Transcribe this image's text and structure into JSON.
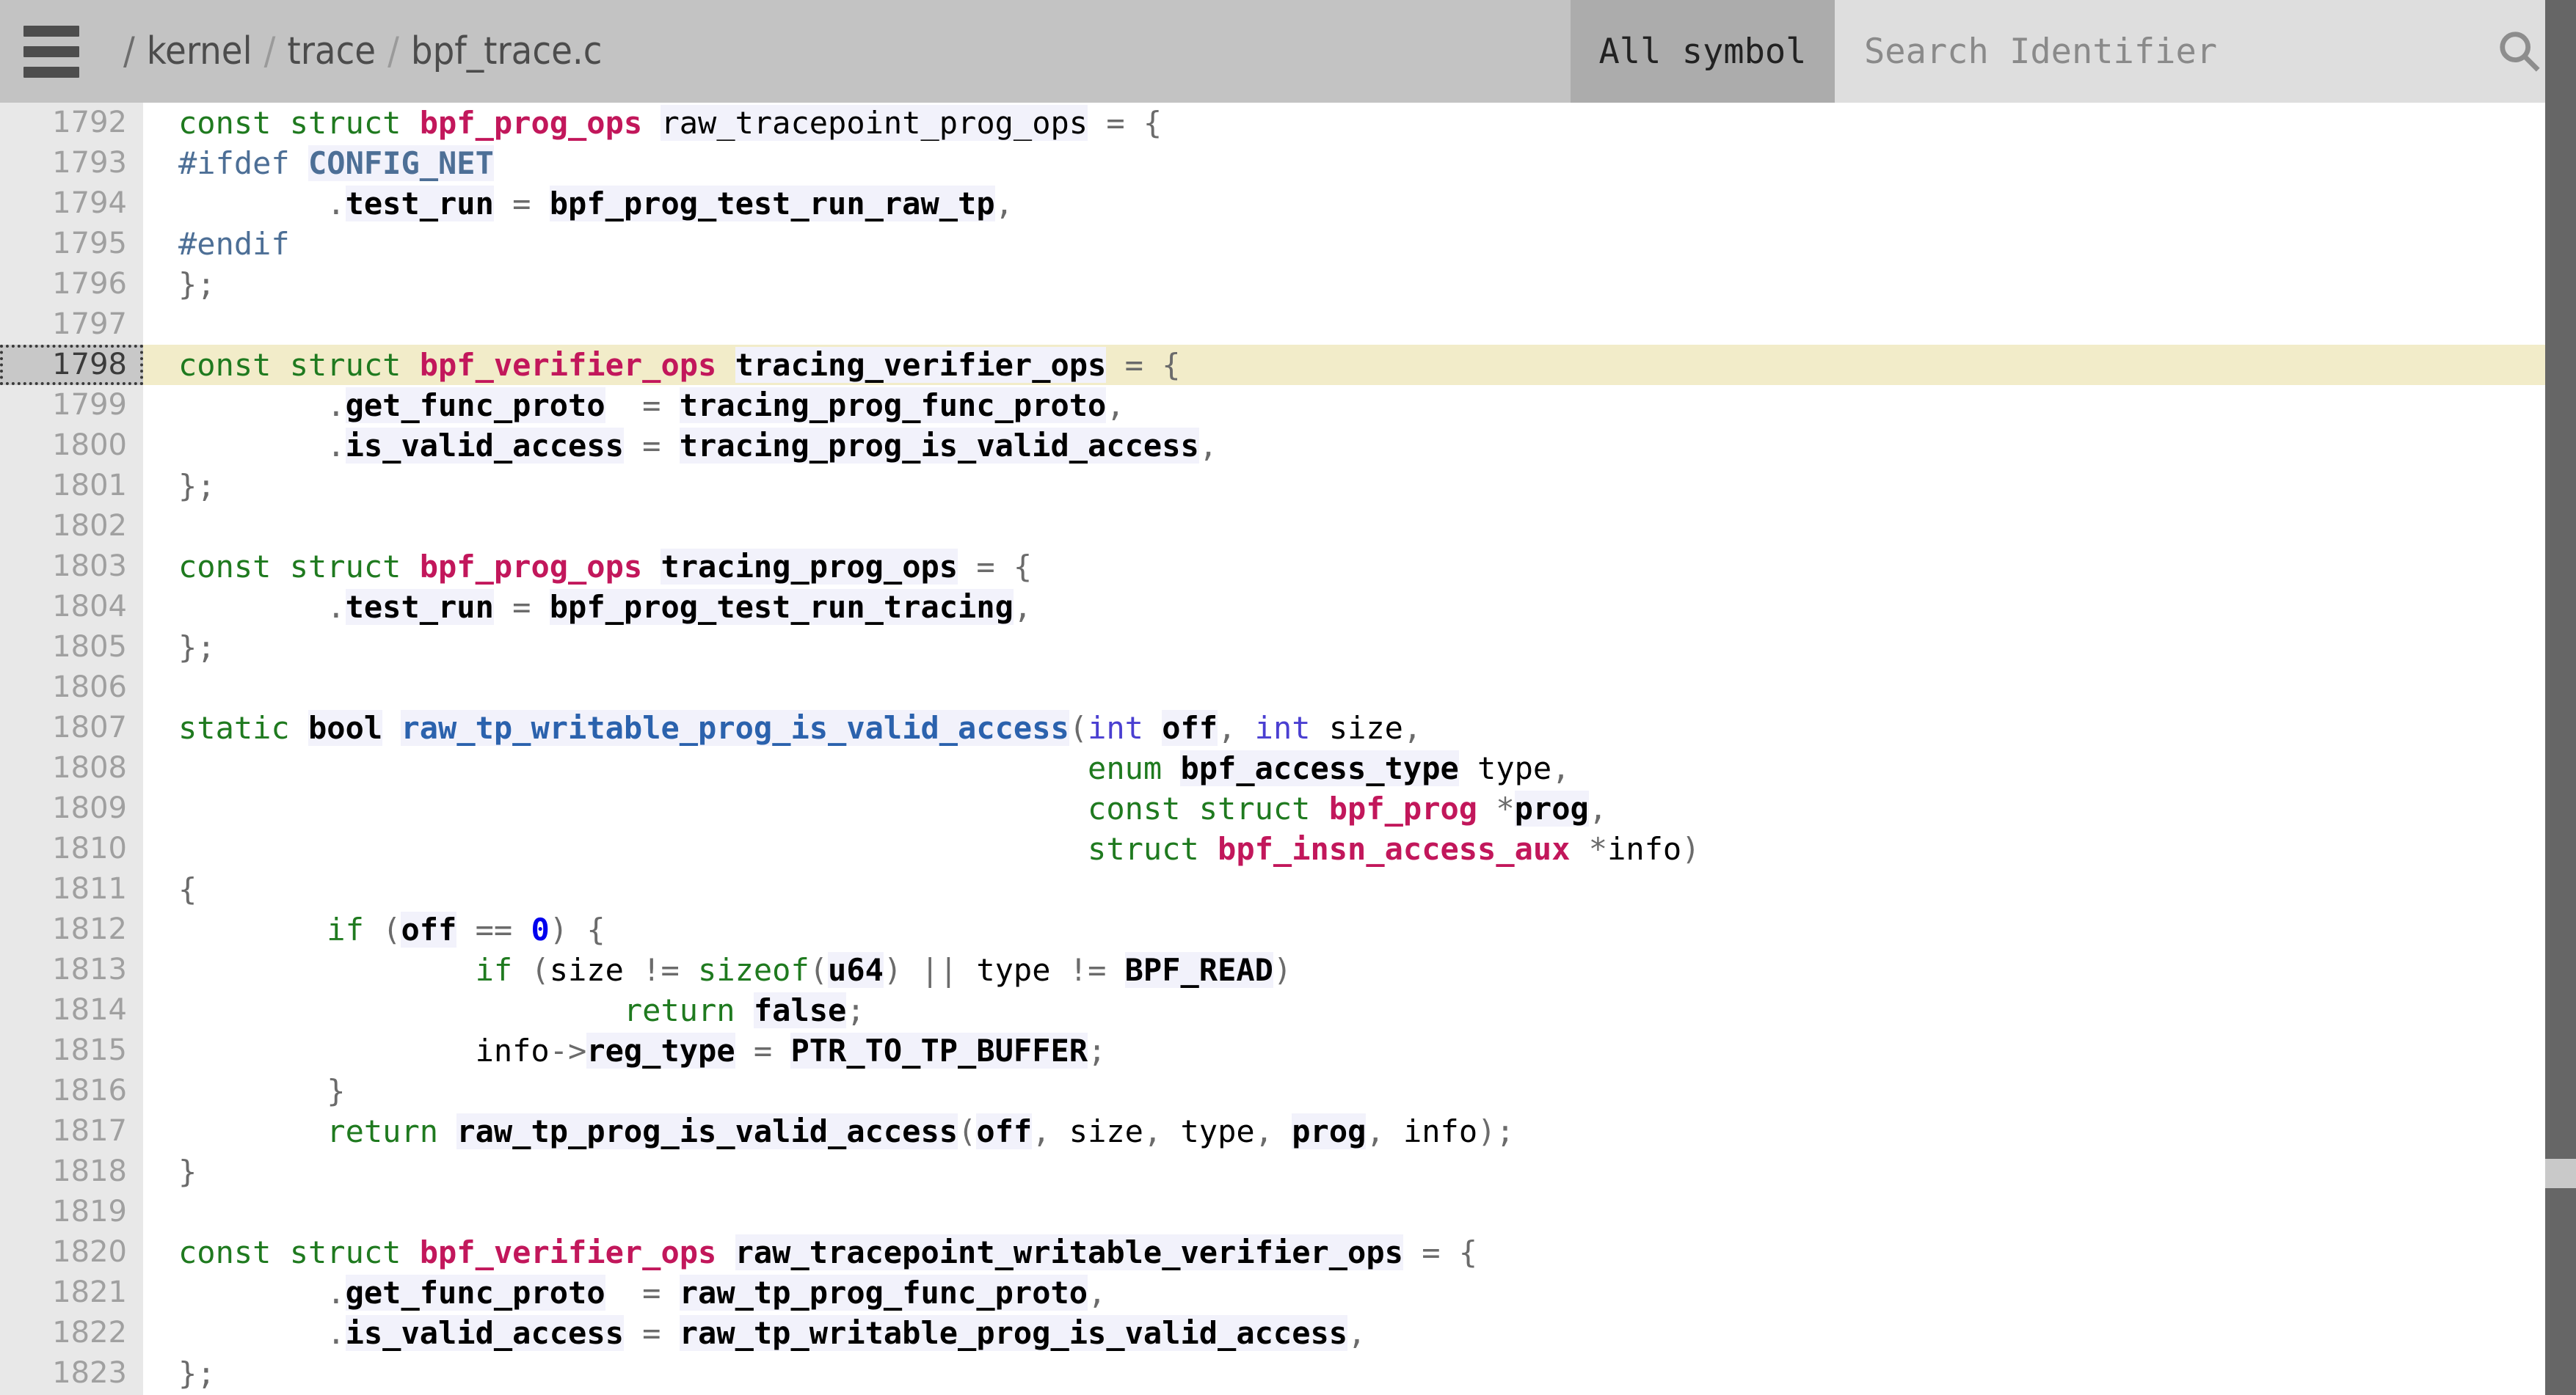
{
  "header": {
    "menu_icon": "hamburger-icon",
    "breadcrumb": {
      "leading_separator": "/",
      "separator": "/",
      "parts": [
        "kernel",
        "trace",
        "bpf_trace.c"
      ]
    },
    "scope_selector": {
      "label": "All symbol",
      "icon": "chevron-down-icon"
    },
    "search": {
      "value": "",
      "placeholder": "Search Identifier",
      "icon": "search-icon"
    }
  },
  "editor": {
    "highlighted_line": 1798,
    "first_line": 1792,
    "last_line": 1823,
    "colors": {
      "keyword": "#1f7a1f",
      "preprocessor": "#4d6f96",
      "type": "#c2175b",
      "function": "#2b62ad",
      "builtin": "#4a3fd1",
      "number": "#0000ee",
      "punctuation": "#6b6b6b",
      "identifier_bg": "#f2f2fb",
      "highlight_bg": "#f2ecc9",
      "gutter_bg": "#e8e8e8",
      "gutter_text": "#a0a0a0",
      "header_bg": "#c3c3c3",
      "scrollbar": "#666666"
    },
    "lines": [
      {
        "n": "1792",
        "text": "const struct bpf_prog_ops raw_tracepoint_prog_ops = {"
      },
      {
        "n": "1793",
        "text": "#ifdef CONFIG_NET"
      },
      {
        "n": "1794",
        "text": "        .test_run = bpf_prog_test_run_raw_tp,"
      },
      {
        "n": "1795",
        "text": "#endif"
      },
      {
        "n": "1796",
        "text": "};"
      },
      {
        "n": "1797",
        "text": ""
      },
      {
        "n": "1798",
        "text": "const struct bpf_verifier_ops tracing_verifier_ops = {"
      },
      {
        "n": "1799",
        "text": "        .get_func_proto  = tracing_prog_func_proto,"
      },
      {
        "n": "1800",
        "text": "        .is_valid_access = tracing_prog_is_valid_access,"
      },
      {
        "n": "1801",
        "text": "};"
      },
      {
        "n": "1802",
        "text": ""
      },
      {
        "n": "1803",
        "text": "const struct bpf_prog_ops tracing_prog_ops = {"
      },
      {
        "n": "1804",
        "text": "        .test_run = bpf_prog_test_run_tracing,"
      },
      {
        "n": "1805",
        "text": "};"
      },
      {
        "n": "1806",
        "text": ""
      },
      {
        "n": "1807",
        "text": "static bool raw_tp_writable_prog_is_valid_access(int off, int size,"
      },
      {
        "n": "1808",
        "text": "                                                 enum bpf_access_type type,"
      },
      {
        "n": "1809",
        "text": "                                                 const struct bpf_prog *prog,"
      },
      {
        "n": "1810",
        "text": "                                                 struct bpf_insn_access_aux *info)"
      },
      {
        "n": "1811",
        "text": "{"
      },
      {
        "n": "1812",
        "text": "        if (off == 0) {"
      },
      {
        "n": "1813",
        "text": "                if (size != sizeof(u64) || type != BPF_READ)"
      },
      {
        "n": "1814",
        "text": "                        return false;"
      },
      {
        "n": "1815",
        "text": "                info->reg_type = PTR_TO_TP_BUFFER;"
      },
      {
        "n": "1816",
        "text": "        }"
      },
      {
        "n": "1817",
        "text": "        return raw_tp_prog_is_valid_access(off, size, type, prog, info);"
      },
      {
        "n": "1818",
        "text": "}"
      },
      {
        "n": "1819",
        "text": ""
      },
      {
        "n": "1820",
        "text": "const struct bpf_verifier_ops raw_tracepoint_writable_verifier_ops = {"
      },
      {
        "n": "1821",
        "text": "        .get_func_proto  = raw_tp_prog_func_proto,"
      },
      {
        "n": "1822",
        "text": "        .is_valid_access = raw_tp_writable_prog_is_valid_access,"
      },
      {
        "n": "1823",
        "text": "};"
      }
    ],
    "tokens": {
      "1792": [
        [
          "kw",
          "const struct "
        ],
        [
          "ty",
          "bpf_prog_ops"
        ],
        [
          "plain",
          " "
        ],
        [
          "id",
          "raw_tracepoint_prog_ops"
        ],
        [
          "pun",
          " = {"
        ]
      ],
      "1793": [
        [
          "pp",
          "#ifdef "
        ],
        [
          "macro",
          "CONFIG_NET"
        ]
      ],
      "1794": [
        [
          "plain",
          "        "
        ],
        [
          "pun",
          "."
        ],
        [
          "idb",
          "test_run"
        ],
        [
          "pun",
          " = "
        ],
        [
          "idb",
          "bpf_prog_test_run_raw_tp"
        ],
        [
          "pun",
          ","
        ]
      ],
      "1795": [
        [
          "pp",
          "#endif"
        ]
      ],
      "1796": [
        [
          "pun",
          "};"
        ]
      ],
      "1797": [],
      "1798": [
        [
          "kw",
          "const struct "
        ],
        [
          "ty",
          "bpf_verifier_ops"
        ],
        [
          "plain",
          " "
        ],
        [
          "idb",
          "tracing_verifier_ops"
        ],
        [
          "pun",
          " = {"
        ]
      ],
      "1799": [
        [
          "plain",
          "        "
        ],
        [
          "pun",
          "."
        ],
        [
          "idb",
          "get_func_proto"
        ],
        [
          "pun",
          "  = "
        ],
        [
          "idb",
          "tracing_prog_func_proto"
        ],
        [
          "pun",
          ","
        ]
      ],
      "1800": [
        [
          "plain",
          "        "
        ],
        [
          "pun",
          "."
        ],
        [
          "idb",
          "is_valid_access"
        ],
        [
          "pun",
          " = "
        ],
        [
          "idb",
          "tracing_prog_is_valid_access"
        ],
        [
          "pun",
          ","
        ]
      ],
      "1801": [
        [
          "pun",
          "};"
        ]
      ],
      "1802": [],
      "1803": [
        [
          "kw",
          "const struct "
        ],
        [
          "ty",
          "bpf_prog_ops"
        ],
        [
          "plain",
          " "
        ],
        [
          "idb",
          "tracing_prog_ops"
        ],
        [
          "pun",
          " = {"
        ]
      ],
      "1804": [
        [
          "plain",
          "        "
        ],
        [
          "pun",
          "."
        ],
        [
          "idb",
          "test_run"
        ],
        [
          "pun",
          " = "
        ],
        [
          "idb",
          "bpf_prog_test_run_tracing"
        ],
        [
          "pun",
          ","
        ]
      ],
      "1805": [
        [
          "pun",
          "};"
        ]
      ],
      "1806": [],
      "1807": [
        [
          "kw",
          "static "
        ],
        [
          "idb",
          "bool"
        ],
        [
          "plain",
          " "
        ],
        [
          "fn",
          "raw_tp_writable_prog_is_valid_access"
        ],
        [
          "pun",
          "("
        ],
        [
          "bt",
          "int "
        ],
        [
          "idb",
          "off"
        ],
        [
          "pun",
          ", "
        ],
        [
          "bt",
          "int "
        ],
        [
          "plain",
          "size"
        ],
        [
          "pun",
          ","
        ]
      ],
      "1808": [
        [
          "plain",
          "                                                 "
        ],
        [
          "kw",
          "enum "
        ],
        [
          "idb",
          "bpf_access_type"
        ],
        [
          "plain",
          " type"
        ],
        [
          "pun",
          ","
        ]
      ],
      "1809": [
        [
          "plain",
          "                                                 "
        ],
        [
          "kw",
          "const struct "
        ],
        [
          "ty",
          "bpf_prog"
        ],
        [
          "pun",
          " *"
        ],
        [
          "idb",
          "prog"
        ],
        [
          "pun",
          ","
        ]
      ],
      "1810": [
        [
          "plain",
          "                                                 "
        ],
        [
          "kw",
          "struct "
        ],
        [
          "ty",
          "bpf_insn_access_aux"
        ],
        [
          "pun",
          " *"
        ],
        [
          "plain",
          "info"
        ],
        [
          "pun",
          ")"
        ]
      ],
      "1811": [
        [
          "pun",
          "{"
        ]
      ],
      "1812": [
        [
          "plain",
          "        "
        ],
        [
          "kw",
          "if "
        ],
        [
          "pun",
          "("
        ],
        [
          "idb",
          "off"
        ],
        [
          "pun",
          " == "
        ],
        [
          "num",
          "0"
        ],
        [
          "pun",
          ") {"
        ]
      ],
      "1813": [
        [
          "plain",
          "                "
        ],
        [
          "kw",
          "if "
        ],
        [
          "pun",
          "("
        ],
        [
          "plain",
          "size "
        ],
        [
          "pun",
          "!= "
        ],
        [
          "kw",
          "sizeof"
        ],
        [
          "pun",
          "("
        ],
        [
          "idb",
          "u64"
        ],
        [
          "pun",
          ") || "
        ],
        [
          "plain",
          "type "
        ],
        [
          "pun",
          "!= "
        ],
        [
          "idb",
          "BPF_READ"
        ],
        [
          "pun",
          ")"
        ]
      ],
      "1814": [
        [
          "plain",
          "                        "
        ],
        [
          "kw",
          "return "
        ],
        [
          "idb",
          "false"
        ],
        [
          "pun",
          ";"
        ]
      ],
      "1815": [
        [
          "plain",
          "                "
        ],
        [
          "plain",
          "info"
        ],
        [
          "pun",
          "->"
        ],
        [
          "idb",
          "reg_type"
        ],
        [
          "pun",
          " = "
        ],
        [
          "idb",
          "PTR_TO_TP_BUFFER"
        ],
        [
          "pun",
          ";"
        ]
      ],
      "1816": [
        [
          "plain",
          "        "
        ],
        [
          "pun",
          "}"
        ]
      ],
      "1817": [
        [
          "plain",
          "        "
        ],
        [
          "kw",
          "return "
        ],
        [
          "idb",
          "raw_tp_prog_is_valid_access"
        ],
        [
          "pun",
          "("
        ],
        [
          "idb",
          "off"
        ],
        [
          "pun",
          ", "
        ],
        [
          "plain",
          "size"
        ],
        [
          "pun",
          ", "
        ],
        [
          "plain",
          "type"
        ],
        [
          "pun",
          ", "
        ],
        [
          "idb",
          "prog"
        ],
        [
          "pun",
          ", "
        ],
        [
          "plain",
          "info"
        ],
        [
          "pun",
          ");"
        ]
      ],
      "1818": [
        [
          "pun",
          "}"
        ]
      ],
      "1819": [],
      "1820": [
        [
          "kw",
          "const struct "
        ],
        [
          "ty",
          "bpf_verifier_ops"
        ],
        [
          "plain",
          " "
        ],
        [
          "idb",
          "raw_tracepoint_writable_verifier_ops"
        ],
        [
          "pun",
          " = {"
        ]
      ],
      "1821": [
        [
          "plain",
          "        "
        ],
        [
          "pun",
          "."
        ],
        [
          "idb",
          "get_func_proto"
        ],
        [
          "pun",
          "  = "
        ],
        [
          "idb",
          "raw_tp_prog_func_proto"
        ],
        [
          "pun",
          ","
        ]
      ],
      "1822": [
        [
          "plain",
          "        "
        ],
        [
          "pun",
          "."
        ],
        [
          "idb",
          "is_valid_access"
        ],
        [
          "pun",
          " = "
        ],
        [
          "idb",
          "raw_tp_writable_prog_is_valid_access"
        ],
        [
          "pun",
          ","
        ]
      ],
      "1823": [
        [
          "pun",
          "};"
        ]
      ]
    }
  }
}
